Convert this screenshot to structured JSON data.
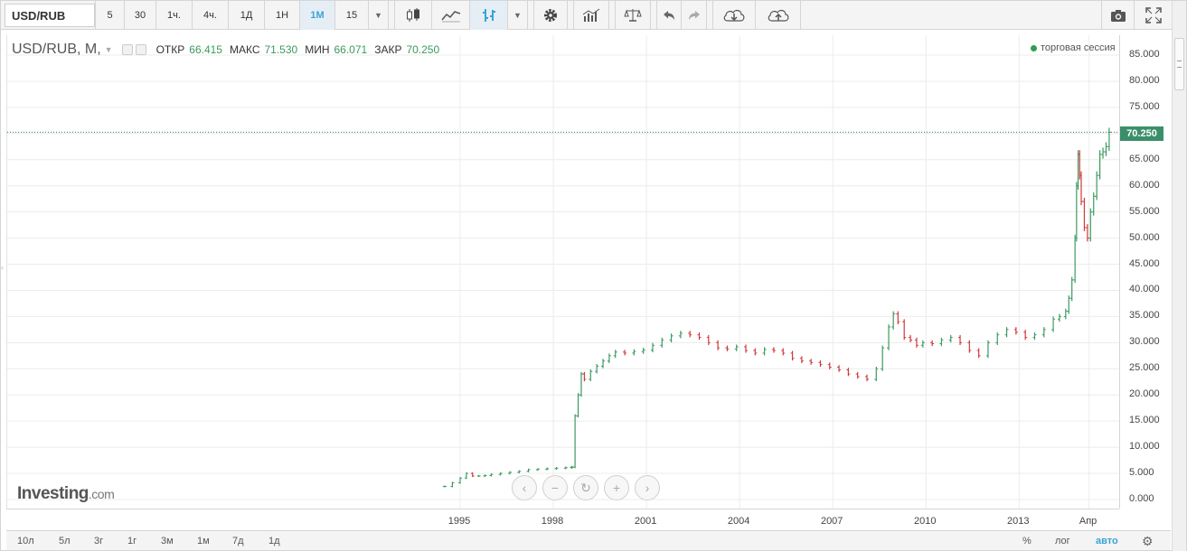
{
  "toolbar": {
    "symbol": "USD/RUB",
    "intervals": [
      "5",
      "30",
      "1ч.",
      "4ч.",
      "1Д",
      "1Н",
      "1М",
      "15"
    ],
    "active_interval": "1М"
  },
  "legend": {
    "symbol": "USD/RUB, M,",
    "open_label": "ОТКР",
    "open": "66.415",
    "high_label": "МАКС",
    "high": "71.530",
    "low_label": "МИН",
    "low": "66.071",
    "close_label": "ЗАКР",
    "close": "70.250",
    "session_label": "торговая сессия"
  },
  "last_price": "70.250",
  "watermark": {
    "brand": "Investing",
    "domain": ".com"
  },
  "ranges": [
    "10л",
    "5л",
    "3г",
    "1г",
    "3м",
    "1м",
    "7д",
    "1д"
  ],
  "scale": {
    "percent": "%",
    "log": "лог",
    "auto": "авто"
  },
  "colors": {
    "up": "#3c9a5f",
    "down": "#d0393a",
    "accent": "#39a3d6",
    "price_line": "#2a7a5c"
  },
  "icons": {
    "candles": "candlestick-icon",
    "line": "line-chart-icon",
    "bars": "ohlc-bar-icon",
    "settings": "gear-icon",
    "indicators": "indicators-icon",
    "compare": "scales-icon",
    "undo": "undo-icon",
    "redo": "redo-icon",
    "load": "cloud-download-icon",
    "save": "cloud-upload-icon",
    "snapshot": "camera-icon",
    "fullscreen": "fullscreen-icon"
  },
  "chart_data": {
    "type": "bar",
    "title": "",
    "y_ticks": [
      "85.000",
      "80.000",
      "75.000",
      "70.000",
      "65.000",
      "60.000",
      "55.000",
      "50.000",
      "45.000",
      "40.000",
      "35.000",
      "30.000",
      "25.000",
      "20.000",
      "15.000",
      "10.000",
      "5.000",
      "0.000"
    ],
    "x_ticks": [
      {
        "label": "1995",
        "year": 1995.0
      },
      {
        "label": "1998",
        "year": 1998.0
      },
      {
        "label": "2001",
        "year": 2001.0
      },
      {
        "label": "2004",
        "year": 2004.0
      },
      {
        "label": "2007",
        "year": 2007.0
      },
      {
        "label": "2010",
        "year": 2010.0
      },
      {
        "label": "2013",
        "year": 2013.0
      },
      {
        "label": "Апр",
        "year": 2015.25
      }
    ],
    "ylim": [
      0,
      85
    ],
    "series": [
      {
        "x": [
          1994.5,
          1994.75,
          1995.0,
          1995.2,
          1995.4,
          1995.6,
          1995.8,
          1996.0,
          1996.3,
          1996.6,
          1996.9,
          1997.2,
          1997.5,
          1997.8,
          1998.1,
          1998.4,
          1998.6
        ],
        "y": [
          2.5,
          3.2,
          4.1,
          5.0,
          4.5,
          4.5,
          4.6,
          4.8,
          5.0,
          5.2,
          5.4,
          5.7,
          5.8,
          5.9,
          6.0,
          6.1,
          6.2
        ]
      },
      {
        "x": [
          1998.6,
          1998.7,
          1998.8,
          1998.9,
          1999.0,
          1999.2,
          1999.4,
          1999.6,
          1999.8,
          2000.0,
          2000.3,
          2000.6,
          2000.9,
          2001.2,
          2001.5,
          2001.8,
          2002.1,
          2002.4,
          2002.7,
          2003.0,
          2003.3,
          2003.6,
          2003.9,
          2004.2,
          2004.5,
          2004.8,
          2005.1,
          2005.4,
          2005.7,
          2006.0,
          2006.3,
          2006.6,
          2006.9,
          2007.2,
          2007.5,
          2007.8,
          2008.1,
          2008.4,
          2008.6,
          2008.8,
          2008.95,
          2009.1,
          2009.3,
          2009.5,
          2009.7,
          2009.9,
          2010.2,
          2010.5,
          2010.8,
          2011.1,
          2011.4,
          2011.7,
          2012.0,
          2012.3,
          2012.6,
          2012.9,
          2013.2,
          2013.5,
          2013.8,
          2014.1,
          2014.3,
          2014.5,
          2014.6,
          2014.7,
          2014.8,
          2014.85,
          2014.9,
          2014.95,
          2015.0,
          2015.1,
          2015.2,
          2015.3,
          2015.4,
          2015.5,
          2015.6,
          2015.7,
          2015.8,
          2015.9
        ],
        "y": [
          6.2,
          16.0,
          20.0,
          24.0,
          23.0,
          24.5,
          25.5,
          26.5,
          27.5,
          28.2,
          28.0,
          28.3,
          28.6,
          29.5,
          30.5,
          31.3,
          31.8,
          31.5,
          31.0,
          30.0,
          29.0,
          28.8,
          29.2,
          28.5,
          28.0,
          28.7,
          28.5,
          28.0,
          27.0,
          26.5,
          26.2,
          25.8,
          25.3,
          24.8,
          24.0,
          23.5,
          23.0,
          25.0,
          29.0,
          33.0,
          35.5,
          34.0,
          31.0,
          30.5,
          29.5,
          30.0,
          29.8,
          30.5,
          31.0,
          30.0,
          28.5,
          27.5,
          30.0,
          31.5,
          32.5,
          32.0,
          31.0,
          31.5,
          32.5,
          34.5,
          35.0,
          36.0,
          38.5,
          42.0,
          50.0,
          60.0,
          66.0,
          62.0,
          57.0,
          52.0,
          50.0,
          55.0,
          58.0,
          62.0,
          66.0,
          66.5,
          67.5,
          70.25
        ]
      }
    ]
  }
}
